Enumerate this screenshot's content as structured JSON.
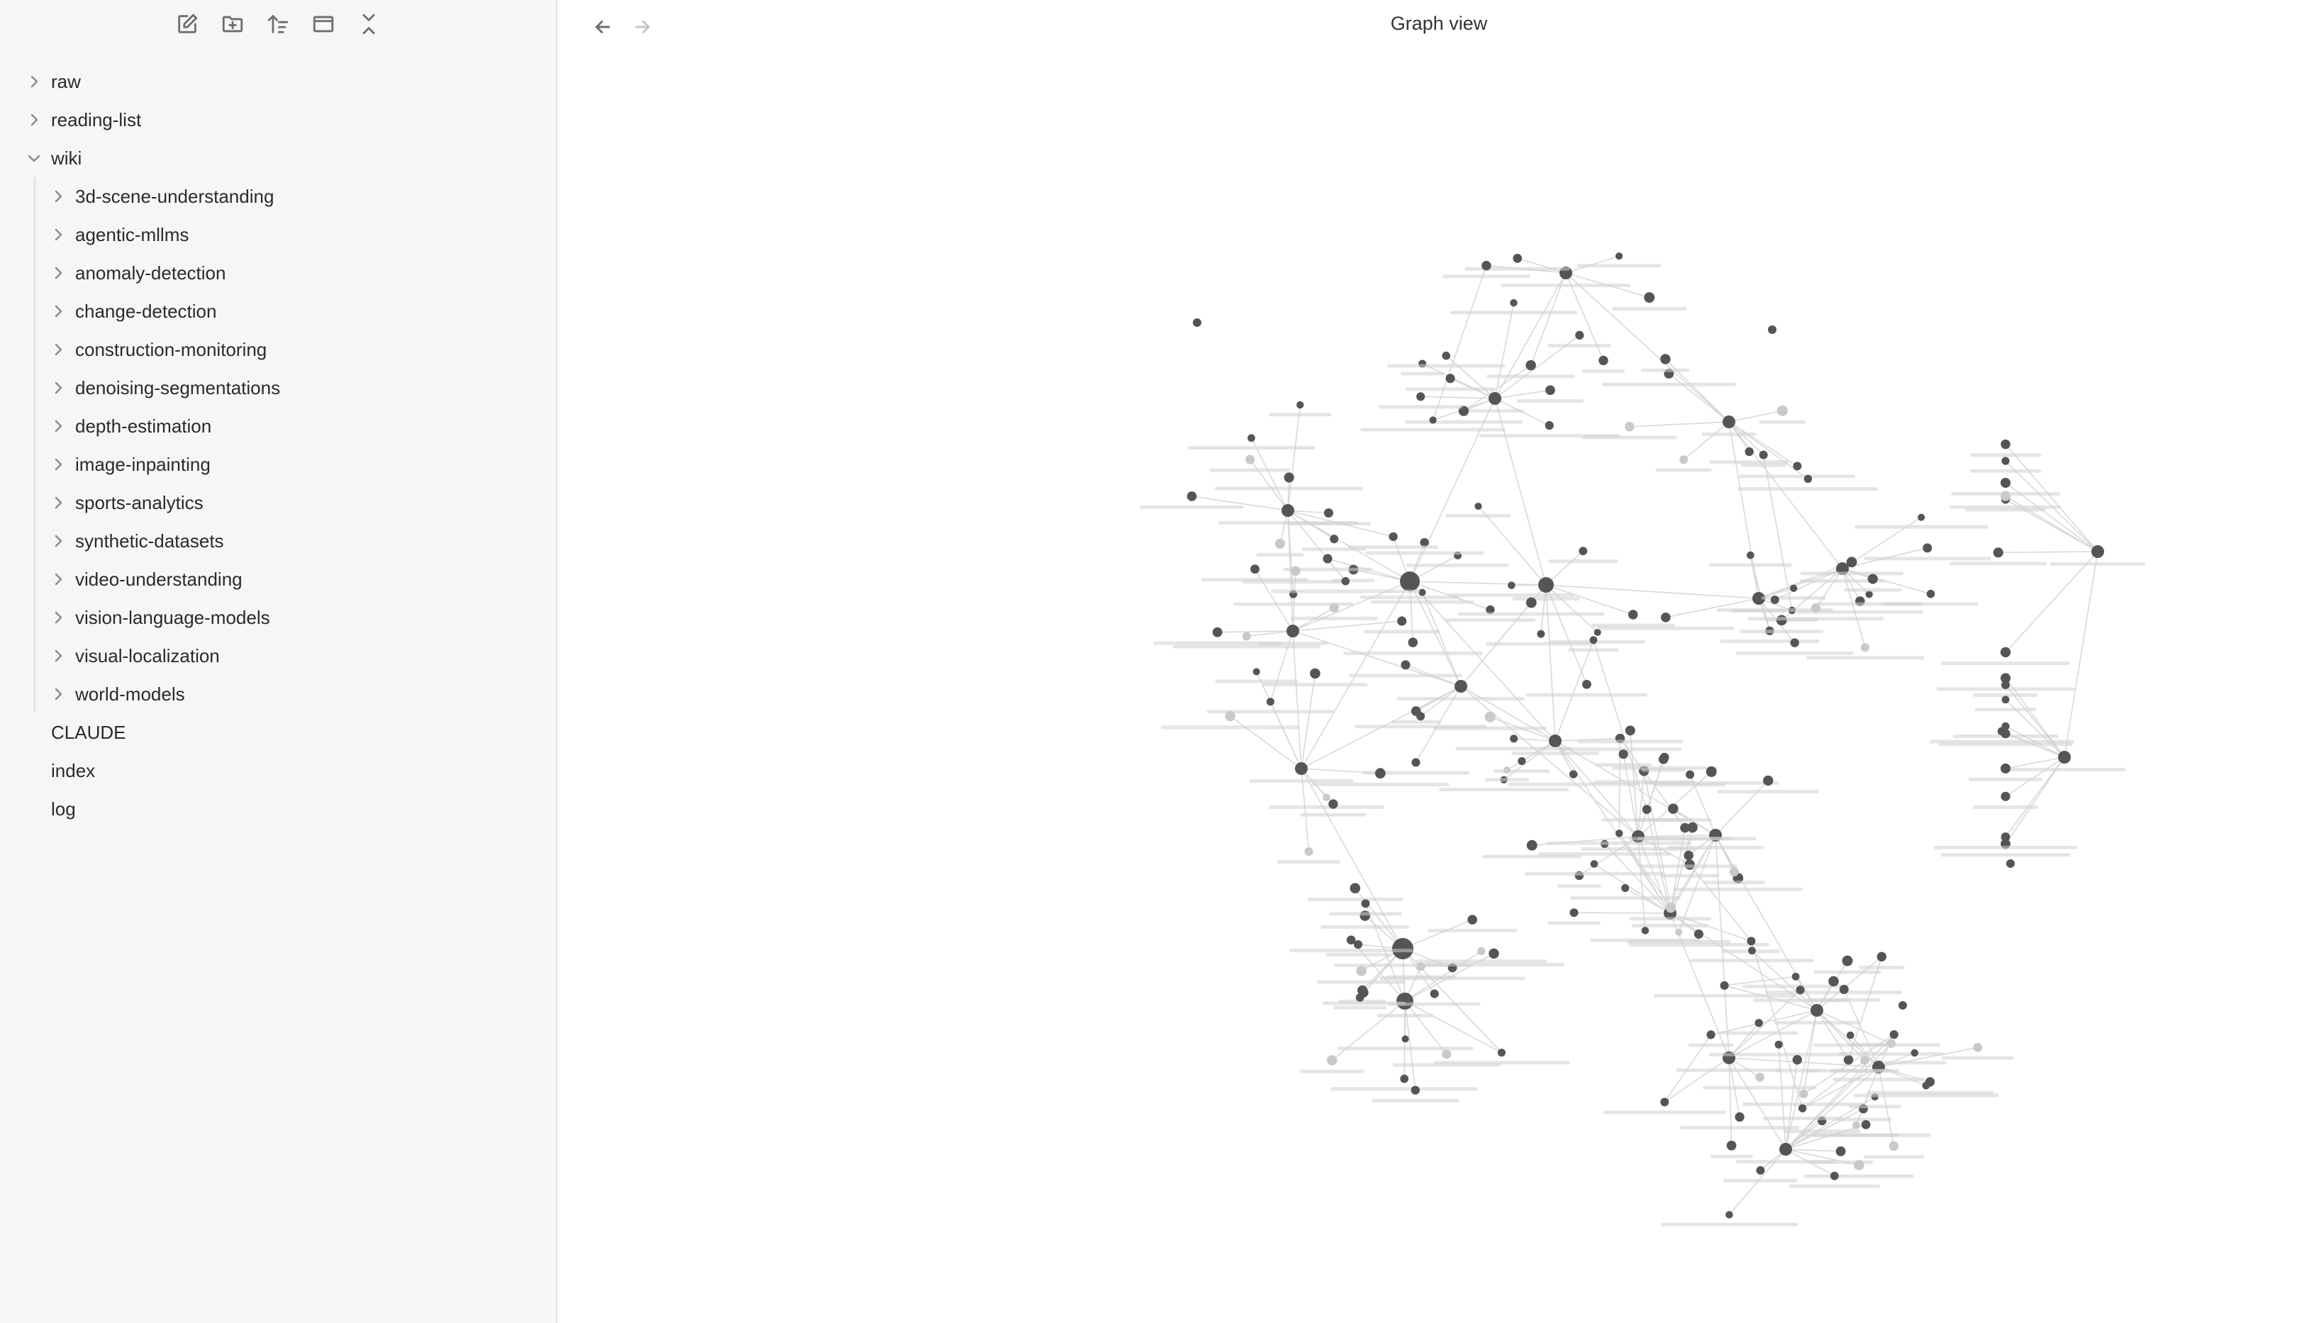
{
  "sidebar": {
    "toolbar": {
      "new_note_icon": "pencil-square-icon",
      "new_folder_icon": "folder-plus-icon",
      "sort_icon": "sort-icon",
      "collapse_icon": "panel-icon",
      "collapse_all_icon": "collapse-all-icon"
    },
    "tree": {
      "raw": "raw",
      "reading_list": "reading-list",
      "wiki": "wiki",
      "children": [
        "3d-scene-understanding",
        "agentic-mllms",
        "anomaly-detection",
        "change-detection",
        "construction-monitoring",
        "denoising-segmentations",
        "depth-estimation",
        "image-inpainting",
        "sports-analytics",
        "synthetic-datasets",
        "video-understanding",
        "vision-language-models",
        "visual-localization",
        "world-models"
      ],
      "claude": "CLAUDE",
      "index": "index",
      "log": "log"
    }
  },
  "main": {
    "title": "Graph view",
    "back_icon": "arrow-left-icon",
    "forward_icon": "arrow-right-icon"
  },
  "colors": {
    "node": "#555555",
    "node_faded": "#c9c9c9",
    "edge": "#d9d9d9",
    "label": "#cfcfcf"
  }
}
